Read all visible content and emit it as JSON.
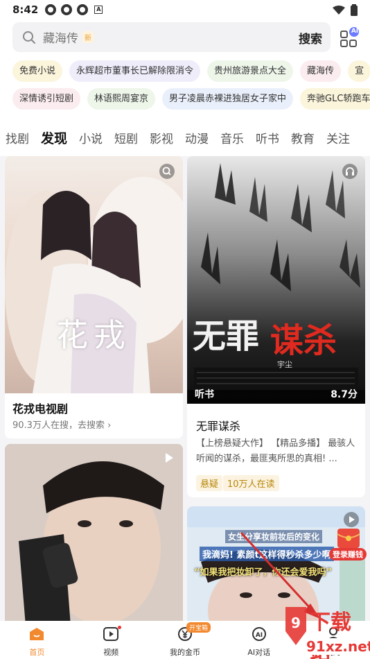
{
  "status_bar": {
    "time": "8:42"
  },
  "search": {
    "placeholder": "藏海传",
    "new_badge": "新",
    "button": "搜索",
    "ai_badge": "AI"
  },
  "hot_tags_row1": [
    "免费小说",
    "永辉超市董事长已解除限消令",
    "贵州旅游景点大全",
    "藏海传",
    "宣"
  ],
  "hot_tags_row2": [
    "深情诱引短剧",
    "林语熙周宴京",
    "男子凌晨赤裸进独居女子家中",
    "奔驰GLC轿跑车"
  ],
  "tabs": [
    "找剧",
    "发现",
    "小说",
    "短剧",
    "影视",
    "动漫",
    "音乐",
    "听书",
    "教育",
    "关注"
  ],
  "card1": {
    "poster_text": "花戎",
    "title": "花戎电视剧",
    "sub": "90.3万人在搜，去搜索 ›"
  },
  "card2": {
    "poster_text_white": "无罪",
    "poster_text_red": "谋杀",
    "author": "宇尘",
    "overlay_left": "听书",
    "overlay_right": "8.7分",
    "title": "无罪谋杀",
    "desc": "【上榜悬疑大作】 【精品多播】 最骇人听闻的谋杀，最匪夷所思的真相! ...",
    "chip1": "悬疑",
    "chip2": "10万人在读"
  },
  "card4": {
    "line1": "女生分享妆前妆后的变化",
    "line2": "我滴妈! 素颜t这样得秒杀多少啊",
    "line3": "“如果我把妆卸了，你还会爱我吗”"
  },
  "float": {
    "label": "登录赚钱"
  },
  "bottom_nav": {
    "home": "首页",
    "video": "视频",
    "coins": "我的金币",
    "coins_badge": "开宝箱",
    "ai": "AI对话",
    "me": "我的"
  },
  "watermark": {
    "top": "下载站",
    "bottom": "91xz.net"
  },
  "colors": {
    "accent": "#f2892f",
    "red": "#e53935"
  }
}
